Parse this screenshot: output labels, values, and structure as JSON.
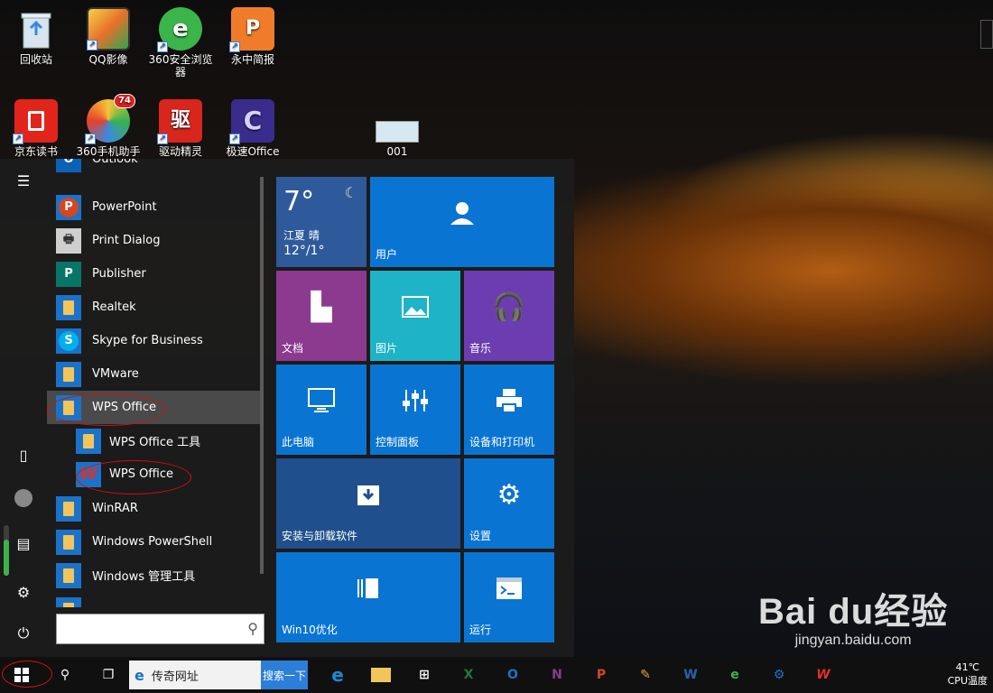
{
  "desktop": {
    "icons": [
      {
        "label": "回收站",
        "icon": "recycle-bin-icon"
      },
      {
        "label": "QQ影像",
        "icon": "qq-image-icon"
      },
      {
        "label": "360安全浏览器",
        "icon": "360-browser-icon"
      },
      {
        "label": "永中简报",
        "icon": "yozo-slides-icon",
        "glyph": "P"
      },
      {
        "label": "京东读书",
        "icon": "jd-reader-icon"
      },
      {
        "label": "360手机助手",
        "icon": "360-phone-icon",
        "badge": "74"
      },
      {
        "label": "驱动精灵",
        "icon": "driver-genius-icon",
        "glyph": "驱"
      },
      {
        "label": "极速Office",
        "icon": "jisu-office-icon",
        "glyph": "C"
      },
      {
        "label": "001",
        "icon": "image-file-icon"
      }
    ]
  },
  "start_menu": {
    "apps": [
      {
        "label": "Outlook",
        "icon": "outlook-icon"
      },
      {
        "label": "PowerPoint",
        "icon": "powerpoint-icon",
        "glyph": "P"
      },
      {
        "label": "Print Dialog",
        "icon": "printer-icon"
      },
      {
        "label": "Publisher",
        "icon": "publisher-icon",
        "glyph": "P"
      },
      {
        "label": "Realtek",
        "icon": "folder-icon"
      },
      {
        "label": "Skype for Business",
        "icon": "skype-icon",
        "glyph": "S"
      },
      {
        "label": "VMware",
        "icon": "folder-icon"
      },
      {
        "label": "WPS Office",
        "icon": "folder-icon"
      },
      {
        "label": "WPS Office 工具",
        "icon": "folder-icon"
      },
      {
        "label": "WPS Office",
        "icon": "wps-icon",
        "glyph": "W"
      },
      {
        "label": "WinRAR",
        "icon": "folder-icon"
      },
      {
        "label": "Windows PowerShell",
        "icon": "folder-icon"
      },
      {
        "label": "Windows 管理工具",
        "icon": "folder-icon"
      }
    ],
    "weather": {
      "temp": "7°",
      "city": "江夏",
      "cond": "晴",
      "range": "12°/1°"
    },
    "tiles": {
      "user": "用户",
      "docs": "文档",
      "pics": "图片",
      "music": "音乐",
      "pc": "此电脑",
      "control": "控制面板",
      "devices": "设备和打印机",
      "install": "安装与卸载软件",
      "settings": "设置",
      "optimize": "Win10优化",
      "run": "运行"
    }
  },
  "taskbar": {
    "search_text": "传奇网址",
    "search_button": "搜索一下",
    "tray_temp": "41℃",
    "tray_label": "CPU温度"
  },
  "watermark": {
    "brand": "Bai  du经验",
    "url": "jingyan.baidu.com"
  },
  "colors": {
    "tile_blue": "#0a74d2",
    "tile_purple": "#8b3a8f",
    "tile_teal": "#1fb3c8",
    "tile_violet": "#6b3db0",
    "tile_navy": "#1f4f8c"
  }
}
